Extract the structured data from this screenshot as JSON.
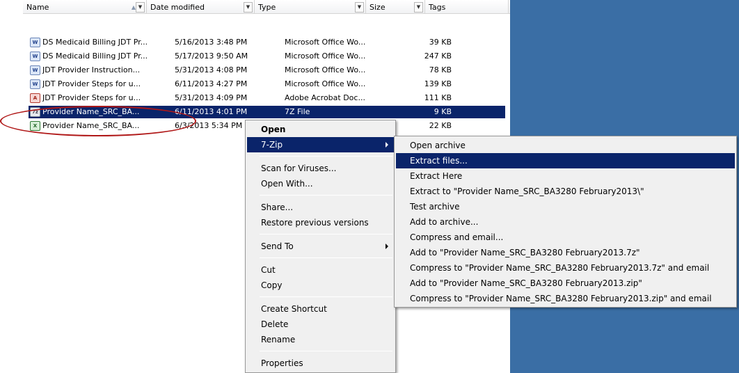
{
  "columns": {
    "name": "Name",
    "date_modified": "Date modified",
    "type": "Type",
    "size": "Size",
    "tags": "Tags"
  },
  "files": [
    {
      "name": "DS Medicaid Billing JDT Pr...",
      "date": "5/16/2013 3:48 PM",
      "type": "Microsoft Office Wo...",
      "size": "39 KB",
      "icon": "word-doc-icon"
    },
    {
      "name": "DS Medicaid Billing JDT Pr...",
      "date": "5/17/2013 9:50 AM",
      "type": "Microsoft Office Wo...",
      "size": "247 KB",
      "icon": "word-doc-icon"
    },
    {
      "name": "JDT Provider Instruction...",
      "date": "5/31/2013 4:08 PM",
      "type": "Microsoft Office Wo...",
      "size": "78 KB",
      "icon": "word-doc-icon"
    },
    {
      "name": "JDT Provider Steps for u...",
      "date": "6/11/2013 4:27 PM",
      "type": "Microsoft Office Wo...",
      "size": "139 KB",
      "icon": "word-doc-icon"
    },
    {
      "name": "JDT Provider Steps for u...",
      "date": "5/31/2013 4:09 PM",
      "type": "Adobe Acrobat Doc...",
      "size": "111 KB",
      "icon": "pdf-icon"
    },
    {
      "name": "Provider Name_SRC_BA...",
      "date": "6/11/2013 4:01 PM",
      "type": "7Z File",
      "size": "9 KB",
      "icon": "zip-archive-icon"
    },
    {
      "name": "Provider Name_SRC_BA...",
      "date": "6/3/2013 5:34 PM",
      "type": "",
      "size": "22 KB",
      "icon": "excel-icon"
    }
  ],
  "context_menu": {
    "open": "Open",
    "seven_zip": "7-Zip",
    "scan": "Scan for Viruses...",
    "open_with": "Open With...",
    "share": "Share...",
    "restore": "Restore previous versions",
    "send_to": "Send To",
    "cut": "Cut",
    "copy": "Copy",
    "create_shortcut": "Create Shortcut",
    "delete": "Delete",
    "rename": "Rename",
    "properties": "Properties"
  },
  "zip_submenu": {
    "open_archive": "Open archive",
    "extract_files": "Extract files...",
    "extract_here": "Extract Here",
    "extract_to": "Extract to \"Provider Name_SRC_BA3280 February2013\\\"",
    "test_archive": "Test archive",
    "add_to_archive": "Add to archive...",
    "compress_email": "Compress and email...",
    "add_7z": "Add to \"Provider Name_SRC_BA3280 February2013.7z\"",
    "compress_7z_email": "Compress to \"Provider Name_SRC_BA3280 February2013.7z\" and email",
    "add_zip": "Add to \"Provider Name_SRC_BA3280 February2013.zip\"",
    "compress_zip_email": "Compress to \"Provider Name_SRC_BA3280 February2013.zip\" and email"
  },
  "colors": {
    "selection": "#0a246a",
    "desktop": "#3a6ea5",
    "annotation_circle": "#b01818"
  }
}
